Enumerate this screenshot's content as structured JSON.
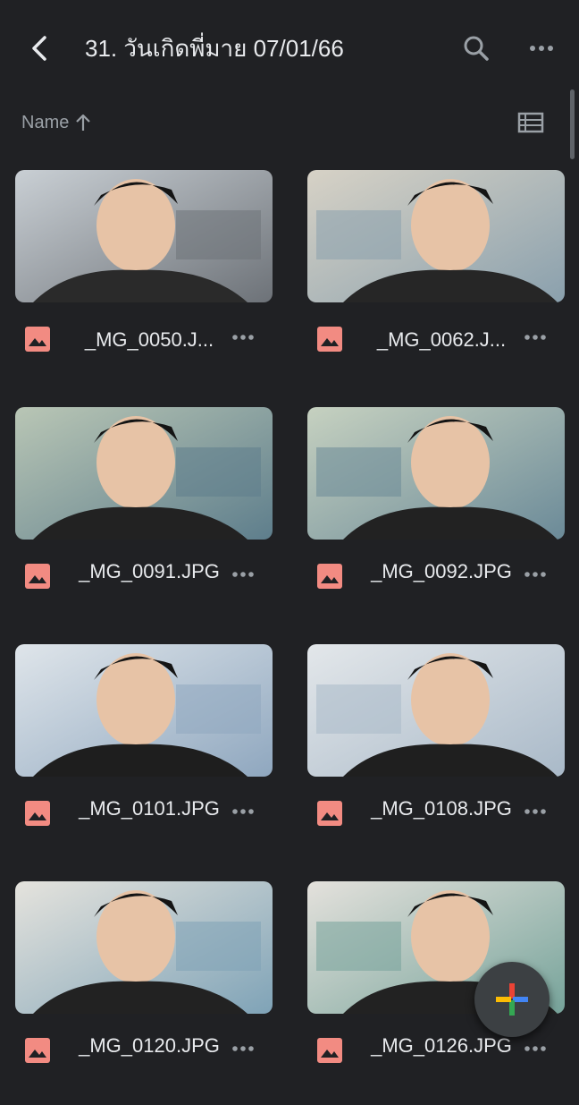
{
  "header": {
    "title": "31. วันเกิดพี่มาย 07/01/66",
    "back_icon": "chevron-left-icon",
    "search_icon": "search-icon",
    "more_icon": "more-horizontal-icon"
  },
  "sort": {
    "label": "Name",
    "direction_icon": "arrow-up-icon",
    "view_icon": "list-view-icon"
  },
  "files": [
    {
      "name": "_MG_0050.J...",
      "type_icon": "image-file-icon"
    },
    {
      "name": "_MG_0062.J...",
      "type_icon": "image-file-icon"
    },
    {
      "name": "_MG_0091.JPG",
      "type_icon": "image-file-icon"
    },
    {
      "name": "_MG_0092.JPG",
      "type_icon": "image-file-icon"
    },
    {
      "name": "_MG_0101.JPG",
      "type_icon": "image-file-icon"
    },
    {
      "name": "_MG_0108.JPG",
      "type_icon": "image-file-icon"
    },
    {
      "name": "_MG_0120.JPG",
      "type_icon": "image-file-icon"
    },
    {
      "name": "_MG_0126.JPG",
      "type_icon": "image-file-icon"
    }
  ],
  "fab": {
    "icon": "plus-icon"
  },
  "colors": {
    "background": "#202124",
    "text": "#e8eaed",
    "muted": "#9aa0a6",
    "image_icon": "#f28b82",
    "google_blue": "#4285f4",
    "google_red": "#ea4335",
    "google_yellow": "#fbbc04",
    "google_green": "#34a853"
  }
}
